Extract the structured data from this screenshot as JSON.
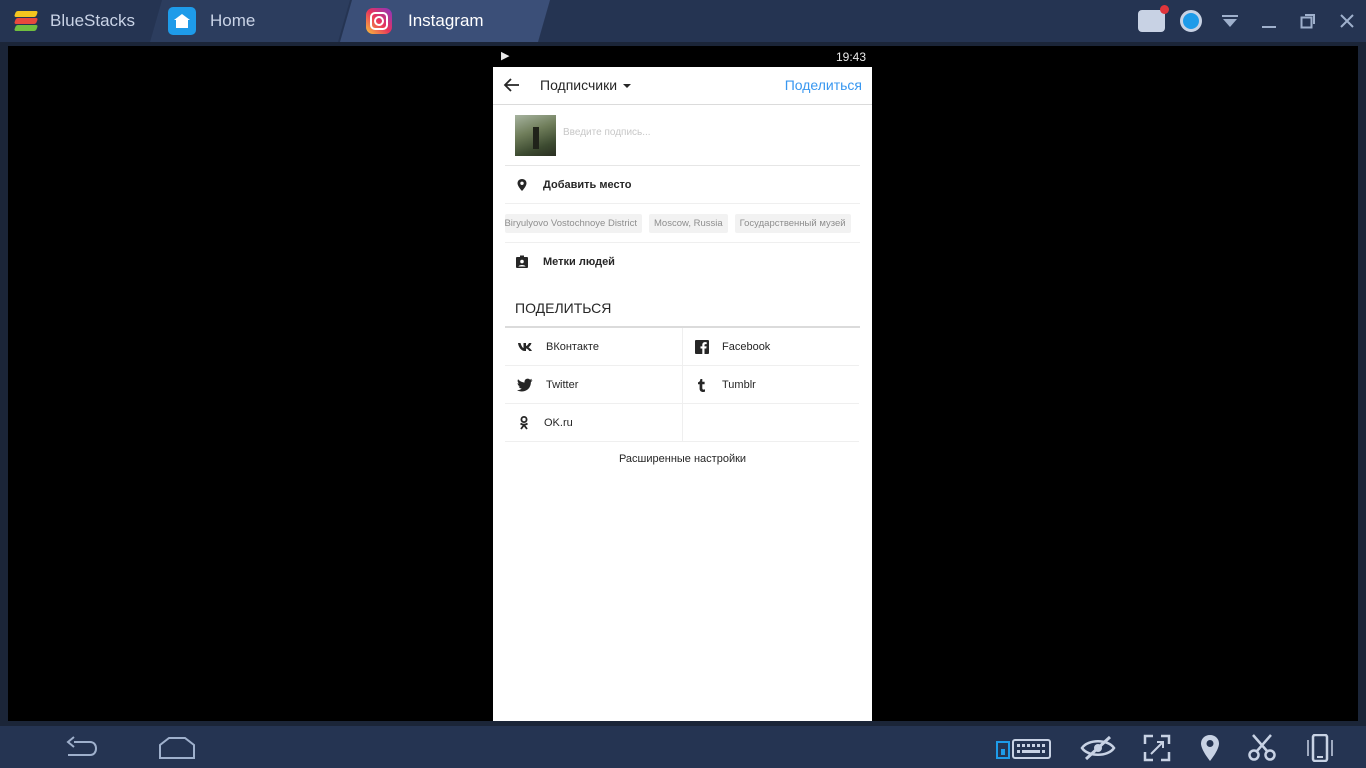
{
  "titlebar": {
    "app_name": "BlueStacks",
    "tabs": [
      {
        "label": "Home",
        "icon": "home-icon"
      },
      {
        "label": "Instagram",
        "icon": "instagram-icon"
      }
    ]
  },
  "statusbar": {
    "time": "19:43"
  },
  "appbar": {
    "title": "Подписчики",
    "share_label": "Поделиться"
  },
  "caption": {
    "placeholder": "Введите подпись..."
  },
  "location": {
    "label": "Добавить место",
    "suggestions": [
      "Tsaritsyno Orekhovo-Borisovo Biryulyovo Vostochnoye District",
      "Moscow, Russia",
      "Государственный музей"
    ]
  },
  "tag_people": {
    "label": "Метки людей"
  },
  "share_section": {
    "title": "ПОДЕЛИТЬСЯ",
    "targets": [
      {
        "label": "ВКонтакте",
        "icon": "vk-icon"
      },
      {
        "label": "Facebook",
        "icon": "facebook-icon"
      },
      {
        "label": "Twitter",
        "icon": "twitter-icon"
      },
      {
        "label": "Tumblr",
        "icon": "tumblr-icon"
      },
      {
        "label": "OK.ru",
        "icon": "odnoklassniki-icon"
      }
    ]
  },
  "advanced_settings": "Расширенные настройки",
  "colors": {
    "accent": "#3897f0",
    "chrome": "#253452",
    "active_tab": "#3b4f78"
  }
}
